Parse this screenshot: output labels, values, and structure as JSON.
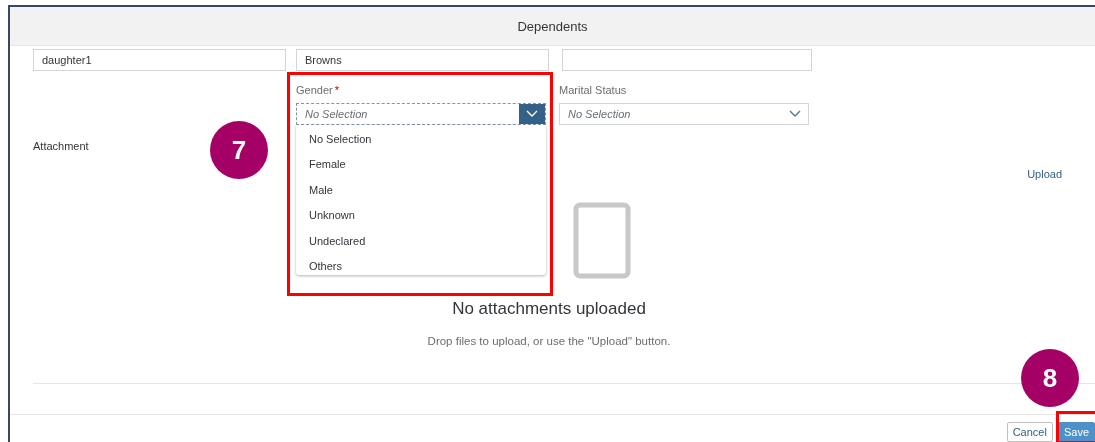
{
  "dialog": {
    "title": "Dependents"
  },
  "fields": [
    {
      "kind": "text",
      "value": "daughter1"
    },
    {
      "kind": "text",
      "value": "Browns"
    },
    {
      "kind": "text"
    }
  ],
  "gender": {
    "label": "Gender",
    "required_mark": "*",
    "placeholder": "No Selection",
    "open": true,
    "options": [
      {
        "label": "No Selection"
      },
      {
        "label": "Female"
      },
      {
        "label": "Male"
      },
      {
        "label": "Unknown"
      },
      {
        "label": "Undeclared"
      },
      {
        "label": "Others"
      }
    ]
  },
  "marital_status": {
    "label": "Marital Status",
    "placeholder": "No Selection"
  },
  "attachment": {
    "label": "Attachment",
    "upload_link": "Upload",
    "empty_title": "No attachments uploaded",
    "empty_hint": "Drop files to upload, or use the \"Upload\" button."
  },
  "buttons": [
    {
      "label": "Cancel",
      "kind": "secondary"
    },
    {
      "label": "Save",
      "kind": "primary"
    }
  ],
  "callouts": [
    {
      "number": "7"
    },
    {
      "number": "8"
    }
  ]
}
